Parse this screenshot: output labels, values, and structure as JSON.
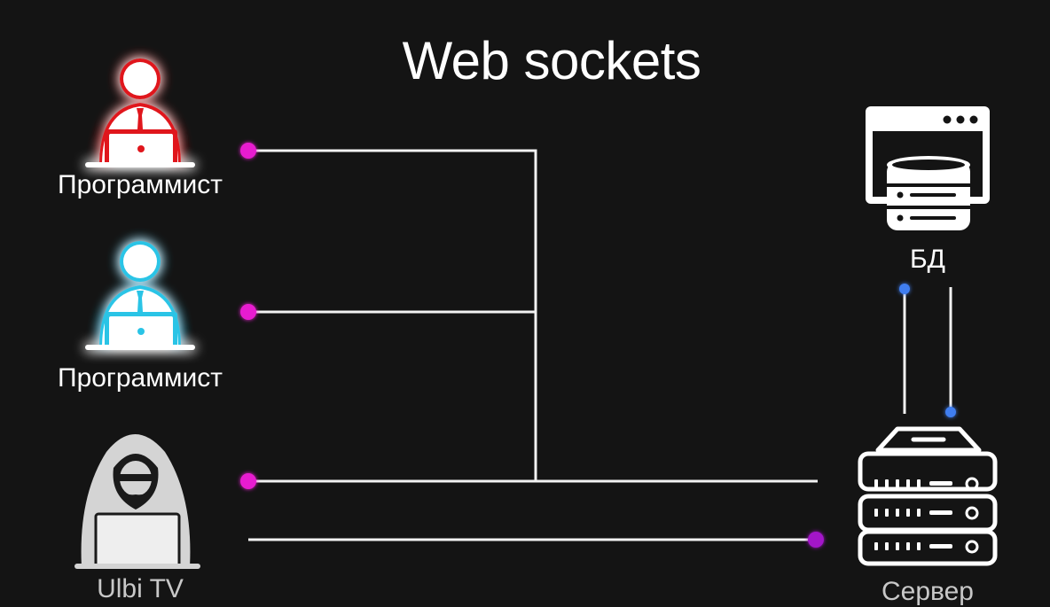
{
  "title": "Web sockets",
  "nodes": {
    "programmer1": {
      "label": "Программист",
      "glow_color": "#e0131a"
    },
    "programmer2": {
      "label": "Программист",
      "glow_color": "#2bc4e6"
    },
    "hacker": {
      "label": "Ulbi TV"
    },
    "database": {
      "label": "БД"
    },
    "server": {
      "label": "Сервер"
    }
  },
  "colors": {
    "background": "#141414",
    "line": "#f2f2f2",
    "client_dot": "#e81fd0",
    "hacker_dot": "#a312c9",
    "db_dot": "#3f7ef0"
  }
}
